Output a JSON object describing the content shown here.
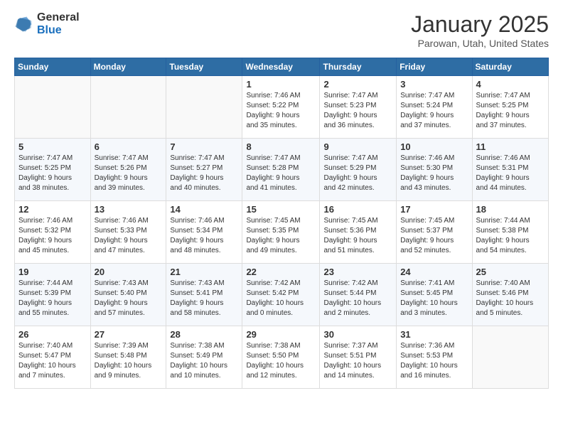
{
  "header": {
    "logo_general": "General",
    "logo_blue": "Blue",
    "title": "January 2025",
    "location": "Parowan, Utah, United States"
  },
  "days_of_week": [
    "Sunday",
    "Monday",
    "Tuesday",
    "Wednesday",
    "Thursday",
    "Friday",
    "Saturday"
  ],
  "weeks": [
    [
      {
        "day": "",
        "info": ""
      },
      {
        "day": "",
        "info": ""
      },
      {
        "day": "",
        "info": ""
      },
      {
        "day": "1",
        "info": "Sunrise: 7:46 AM\nSunset: 5:22 PM\nDaylight: 9 hours\nand 35 minutes."
      },
      {
        "day": "2",
        "info": "Sunrise: 7:47 AM\nSunset: 5:23 PM\nDaylight: 9 hours\nand 36 minutes."
      },
      {
        "day": "3",
        "info": "Sunrise: 7:47 AM\nSunset: 5:24 PM\nDaylight: 9 hours\nand 37 minutes."
      },
      {
        "day": "4",
        "info": "Sunrise: 7:47 AM\nSunset: 5:25 PM\nDaylight: 9 hours\nand 37 minutes."
      }
    ],
    [
      {
        "day": "5",
        "info": "Sunrise: 7:47 AM\nSunset: 5:25 PM\nDaylight: 9 hours\nand 38 minutes."
      },
      {
        "day": "6",
        "info": "Sunrise: 7:47 AM\nSunset: 5:26 PM\nDaylight: 9 hours\nand 39 minutes."
      },
      {
        "day": "7",
        "info": "Sunrise: 7:47 AM\nSunset: 5:27 PM\nDaylight: 9 hours\nand 40 minutes."
      },
      {
        "day": "8",
        "info": "Sunrise: 7:47 AM\nSunset: 5:28 PM\nDaylight: 9 hours\nand 41 minutes."
      },
      {
        "day": "9",
        "info": "Sunrise: 7:47 AM\nSunset: 5:29 PM\nDaylight: 9 hours\nand 42 minutes."
      },
      {
        "day": "10",
        "info": "Sunrise: 7:46 AM\nSunset: 5:30 PM\nDaylight: 9 hours\nand 43 minutes."
      },
      {
        "day": "11",
        "info": "Sunrise: 7:46 AM\nSunset: 5:31 PM\nDaylight: 9 hours\nand 44 minutes."
      }
    ],
    [
      {
        "day": "12",
        "info": "Sunrise: 7:46 AM\nSunset: 5:32 PM\nDaylight: 9 hours\nand 45 minutes."
      },
      {
        "day": "13",
        "info": "Sunrise: 7:46 AM\nSunset: 5:33 PM\nDaylight: 9 hours\nand 47 minutes."
      },
      {
        "day": "14",
        "info": "Sunrise: 7:46 AM\nSunset: 5:34 PM\nDaylight: 9 hours\nand 48 minutes."
      },
      {
        "day": "15",
        "info": "Sunrise: 7:45 AM\nSunset: 5:35 PM\nDaylight: 9 hours\nand 49 minutes."
      },
      {
        "day": "16",
        "info": "Sunrise: 7:45 AM\nSunset: 5:36 PM\nDaylight: 9 hours\nand 51 minutes."
      },
      {
        "day": "17",
        "info": "Sunrise: 7:45 AM\nSunset: 5:37 PM\nDaylight: 9 hours\nand 52 minutes."
      },
      {
        "day": "18",
        "info": "Sunrise: 7:44 AM\nSunset: 5:38 PM\nDaylight: 9 hours\nand 54 minutes."
      }
    ],
    [
      {
        "day": "19",
        "info": "Sunrise: 7:44 AM\nSunset: 5:39 PM\nDaylight: 9 hours\nand 55 minutes."
      },
      {
        "day": "20",
        "info": "Sunrise: 7:43 AM\nSunset: 5:40 PM\nDaylight: 9 hours\nand 57 minutes."
      },
      {
        "day": "21",
        "info": "Sunrise: 7:43 AM\nSunset: 5:41 PM\nDaylight: 9 hours\nand 58 minutes."
      },
      {
        "day": "22",
        "info": "Sunrise: 7:42 AM\nSunset: 5:42 PM\nDaylight: 10 hours\nand 0 minutes."
      },
      {
        "day": "23",
        "info": "Sunrise: 7:42 AM\nSunset: 5:44 PM\nDaylight: 10 hours\nand 2 minutes."
      },
      {
        "day": "24",
        "info": "Sunrise: 7:41 AM\nSunset: 5:45 PM\nDaylight: 10 hours\nand 3 minutes."
      },
      {
        "day": "25",
        "info": "Sunrise: 7:40 AM\nSunset: 5:46 PM\nDaylight: 10 hours\nand 5 minutes."
      }
    ],
    [
      {
        "day": "26",
        "info": "Sunrise: 7:40 AM\nSunset: 5:47 PM\nDaylight: 10 hours\nand 7 minutes."
      },
      {
        "day": "27",
        "info": "Sunrise: 7:39 AM\nSunset: 5:48 PM\nDaylight: 10 hours\nand 9 minutes."
      },
      {
        "day": "28",
        "info": "Sunrise: 7:38 AM\nSunset: 5:49 PM\nDaylight: 10 hours\nand 10 minutes."
      },
      {
        "day": "29",
        "info": "Sunrise: 7:38 AM\nSunset: 5:50 PM\nDaylight: 10 hours\nand 12 minutes."
      },
      {
        "day": "30",
        "info": "Sunrise: 7:37 AM\nSunset: 5:51 PM\nDaylight: 10 hours\nand 14 minutes."
      },
      {
        "day": "31",
        "info": "Sunrise: 7:36 AM\nSunset: 5:53 PM\nDaylight: 10 hours\nand 16 minutes."
      },
      {
        "day": "",
        "info": ""
      }
    ]
  ]
}
